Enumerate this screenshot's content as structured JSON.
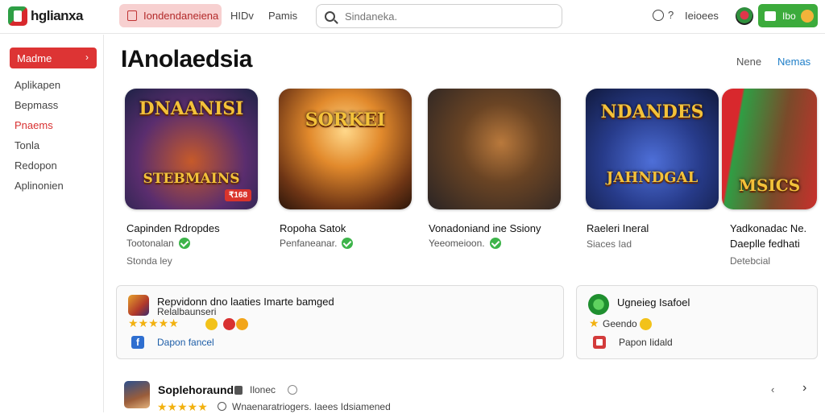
{
  "app": {
    "logo_text": "hglianxa",
    "colors": {
      "accent_red": "#dd3434",
      "accent_green": "#3cab3c",
      "link_blue": "#1e7ec8"
    }
  },
  "topnav": {
    "active_label": "Iondendaneiena",
    "items": [
      "HIDv",
      "Pamis"
    ]
  },
  "search": {
    "placeholder": "Sindaneka."
  },
  "header_right": {
    "help_q": "?",
    "user_text": "Ieioees",
    "button_label": "Ibo"
  },
  "sidebar": {
    "active_label": "Madme",
    "items": [
      "Aplikapen",
      "Bepmass",
      "Pnaems",
      "Tonla",
      "Redopon",
      "Aplinonien"
    ]
  },
  "main": {
    "title": "IAnolaedsia",
    "links": [
      "Nene",
      "Nemas"
    ],
    "games": [
      {
        "art_title": "DNAANISI",
        "art_sub": "STEBMAINS",
        "badge": "₹168",
        "name": "Capinden Rdropdes",
        "sub": "Tootonalan",
        "meta": "Stonda ley"
      },
      {
        "art_title": "SORKEI",
        "name": "Ropoha Satok",
        "sub": "Penfaneanar.",
        "meta": ""
      },
      {
        "art_title": "",
        "name": "Vonadoniand ine Ssiony",
        "sub": "Yeeomeioon.",
        "meta": ""
      },
      {
        "art_title": "NDANDES",
        "art_sub": "JAHNDGAL",
        "name": "Raeleri Ineral",
        "sub": "Siaces Iad",
        "meta": ""
      },
      {
        "art_title": "MSICS",
        "name": "Yadkonadac Ne.",
        "name2": "Daeplle fedhati",
        "meta": "Detebcial"
      }
    ]
  },
  "cards": [
    {
      "title": "Repvidonn dno laaties Imarte bamged",
      "sub": "Relalbaunseri",
      "link": "Dapon fancel",
      "stars": "★★★★★"
    },
    {
      "title": "Ugneieg Isafoel",
      "sub": "Geendo",
      "link": "Papon Iidald",
      "stars": "★"
    }
  ],
  "bottom": {
    "title": "Soplehoraund",
    "tag": "Ilonec",
    "stars": "★★★★★",
    "meta": "Wnaenaratriogers. Iaees Idsiamened",
    "dots": "‹",
    "next": "›"
  }
}
